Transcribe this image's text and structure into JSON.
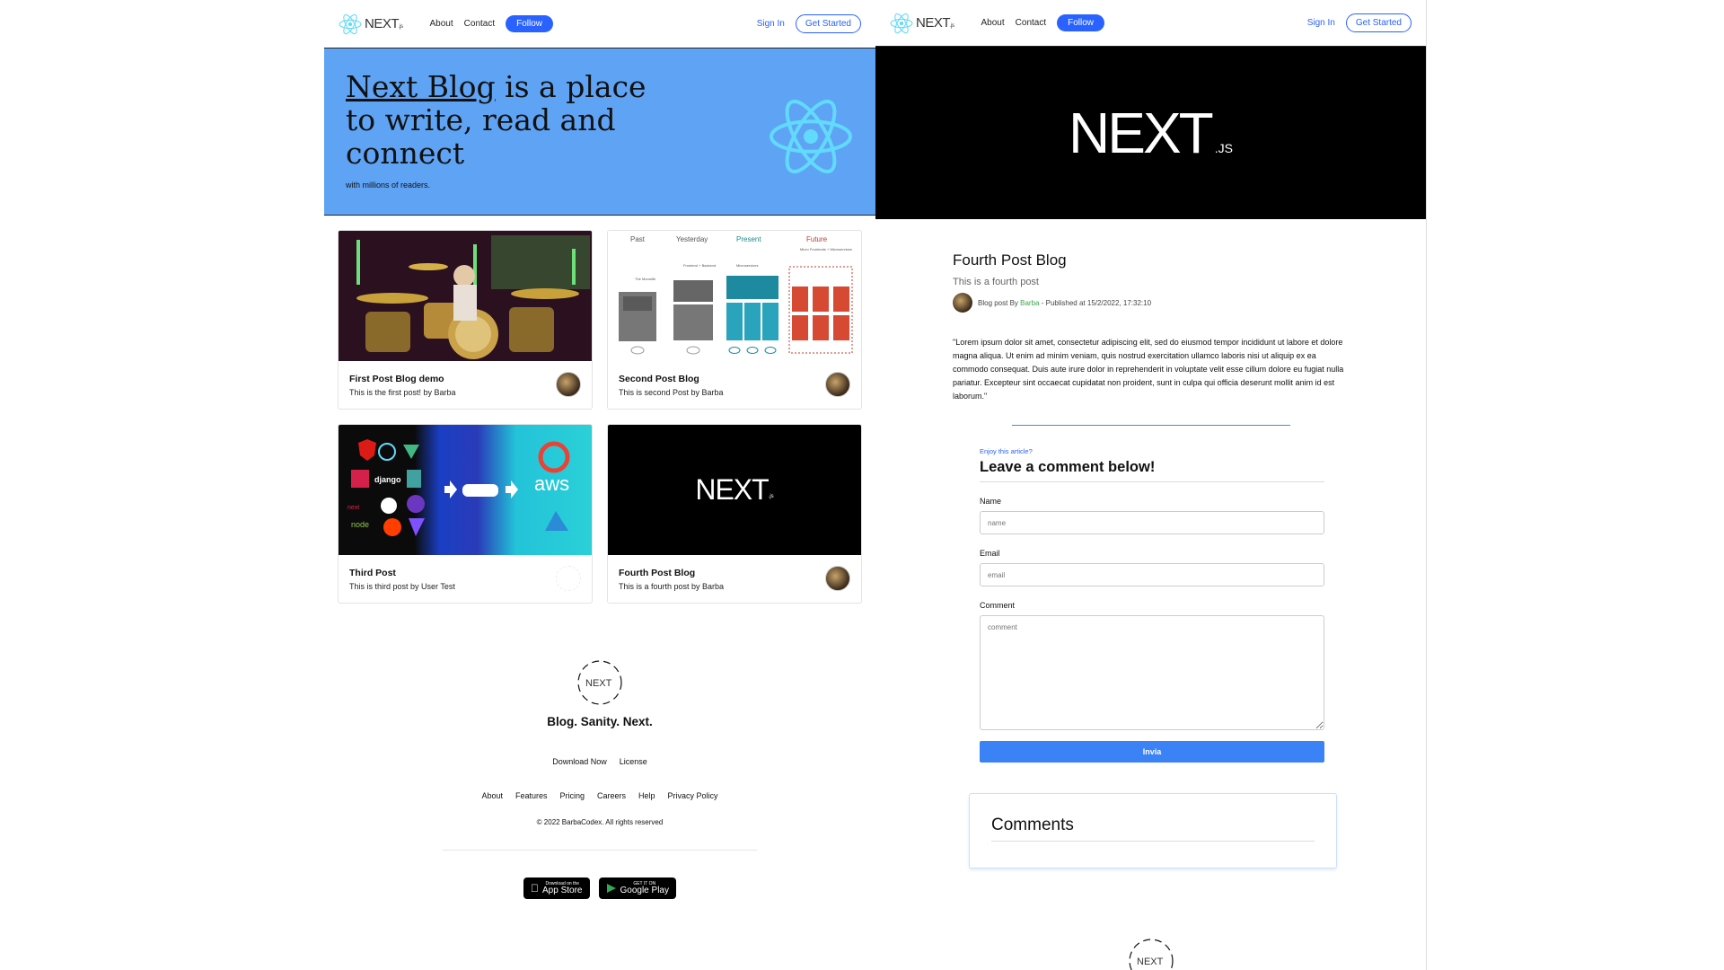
{
  "left": {
    "nav": {
      "logo": "NEXT",
      "logo_suffix": ".js",
      "about": "About",
      "contact": "Contact",
      "follow": "Follow",
      "signin": "Sign In",
      "get_started": "Get Started"
    },
    "hero": {
      "title_link": "Next Blog",
      "title_rest": " is a place to write, read and connect",
      "subtitle": "with millions of readers."
    },
    "cards": [
      {
        "title": "First Post Blog demo",
        "subtitle": "This is the first post! by Barba"
      },
      {
        "title": "Second Post Blog",
        "subtitle": "This is second Post by Barba"
      },
      {
        "title": "Third Post",
        "subtitle": "This is third post by User Test"
      },
      {
        "title": "Fourth Post Blog",
        "subtitle": "This is a fourth post by Barba"
      }
    ],
    "card2_labels": {
      "past": "Past",
      "yesterday": "Yesterday",
      "present": "Present",
      "future": "Future",
      "monolith": "The Monolith",
      "frontback": "Frontend + Backend",
      "micro": "Microservices",
      "microfront": "Micro Frontends + Microservices"
    },
    "card3_labels": {
      "aws": "aws",
      "django": "django",
      "node": "node",
      "next": "next"
    },
    "footer": {
      "logo": "NEXT",
      "brand": "Blog. Sanity. Next.",
      "download": "Download Now",
      "license": "License",
      "links": [
        "About",
        "Features",
        "Pricing",
        "Careers",
        "Help",
        "Privacy Policy"
      ],
      "copyright": "© 2022 BarbaCodex. All rights reserved",
      "appstore_small": "Download on the",
      "appstore_big": "App Store",
      "google_small": "GET IT ON",
      "google_big": "Google Play"
    }
  },
  "right": {
    "nav": {
      "logo": "NEXT",
      "logo_suffix": ".js",
      "about": "About",
      "contact": "Contact",
      "follow": "Follow",
      "signin": "Sign In",
      "get_started": "Get Started"
    },
    "banner": {
      "logo": "NEXT",
      "suffix": ".JS"
    },
    "article": {
      "title": "Fourth Post Blog",
      "subtitle": "This is a fourth post",
      "meta_prefix": "Blog post By ",
      "author": "Barba",
      "meta_suffix": " - Published at 15/2/2022, 17:32:10",
      "body": "\"Lorem ipsum dolor sit amet, consectetur adipiscing elit, sed do eiusmod tempor incididunt ut labore et dolore magna aliqua. Ut enim ad minim veniam, quis nostrud exercitation ullamco laboris nisi ut aliquip ex ea commodo consequat. Duis aute irure dolor in reprehenderit in voluptate velit esse cillum dolore eu fugiat nulla pariatur. Excepteur sint occaecat cupidatat non proident, sunt in culpa qui officia deserunt mollit anim id est laborum.\""
    },
    "form": {
      "eyebrow": "Enjoy this article?",
      "heading": "Leave a comment below!",
      "name_label": "Name",
      "name_placeholder": "name",
      "email_label": "Email",
      "email_placeholder": "email",
      "comment_label": "Comment",
      "comment_placeholder": "comment",
      "submit": "Invia"
    },
    "comments": {
      "heading": "Comments"
    },
    "footer_logo": "NEXT"
  },
  "colors": {
    "accent": "#2962ff",
    "hero_bg": "#5fa3f4",
    "react": "#61dafb",
    "submit": "#3b82f6"
  }
}
